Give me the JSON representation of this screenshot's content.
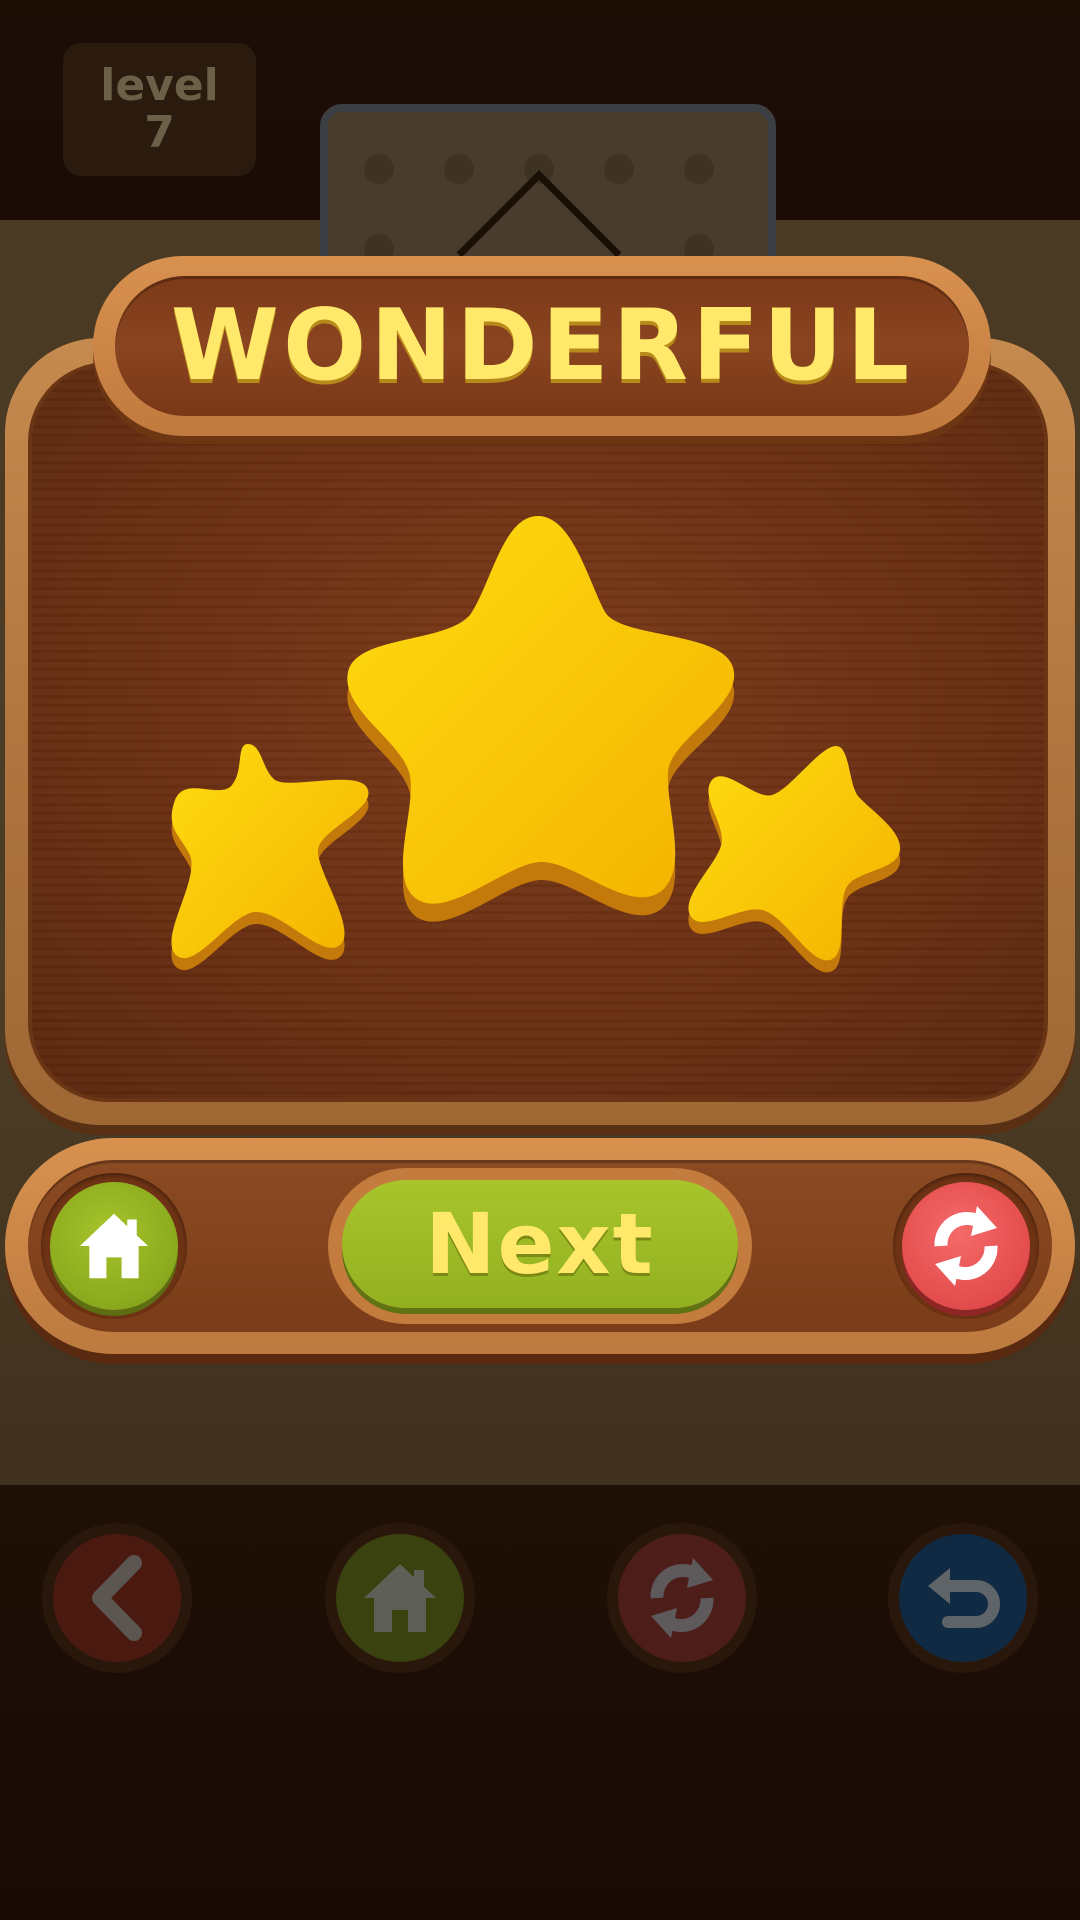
{
  "hud": {
    "level_label": "level",
    "level_number": "7"
  },
  "dialog": {
    "title": "WONDERFUL",
    "stars_earned": 3,
    "stars_total": 3,
    "next_label": "Next"
  },
  "icons": {
    "dialog_home": "home-icon",
    "dialog_restart": "restart-icon",
    "back": "chevron-left-icon",
    "toolbar_home": "home-icon",
    "toolbar_restart": "restart-icon",
    "undo": "undo-icon"
  },
  "colors": {
    "title_text": "#ffe86a",
    "star": "#f8c400",
    "next_button": "#93b020",
    "home_button": "#8aa91d",
    "restart_button": "#e34c4c",
    "undo_button": "#1c3a5c"
  }
}
